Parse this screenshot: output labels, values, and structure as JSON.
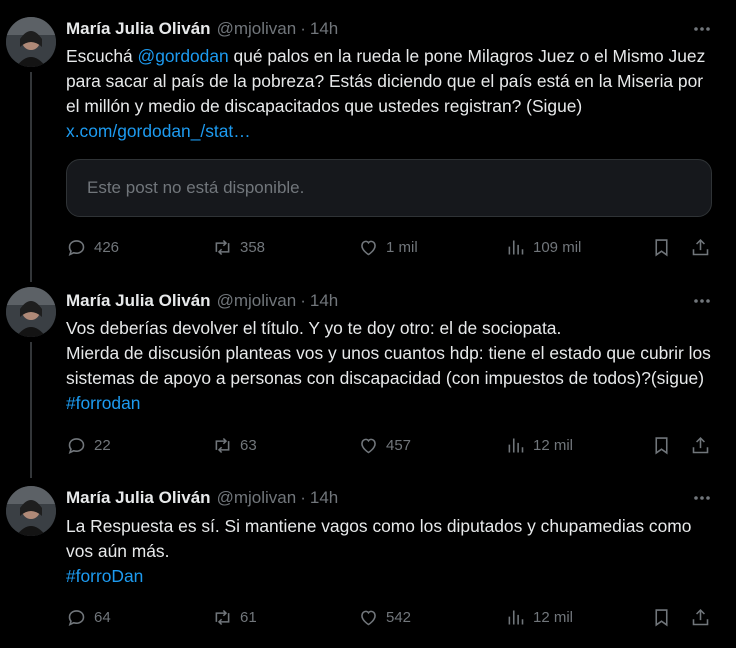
{
  "tweets": [
    {
      "author": {
        "name": "María Julia Oliván",
        "handle": "@mjolivan",
        "time": "14h"
      },
      "text_parts": {
        "p1": "Escuchá ",
        "mention": "@gordodan",
        "p2": " qué palos en la rueda le pone Milagros Juez o el Mismo Juez para sacar al país de la pobreza? Estás diciendo que el país está en la Miseria por el millón y medio de discapacitados que ustedes  registran? (Sigue) ",
        "link": "x.com/gordodan_/stat…"
      },
      "quoted_unavailable": "Este post no está disponible.",
      "stats": {
        "replies": "426",
        "reposts": "358",
        "likes": "1 mil",
        "views": "109 mil"
      }
    },
    {
      "author": {
        "name": "María Julia Oliván",
        "handle": "@mjolivan",
        "time": "14h"
      },
      "text_parts": {
        "p1": "Vos deberías devolver el título. Y yo te doy otro: el de sociopata.\nMierda de discusión planteas vos y unos cuantos hdp: tiene el estado que cubrir los sistemas de apoyo a personas con discapacidad (con impuestos de todos)?(sigue) ",
        "hashtag": "#forrodan"
      },
      "stats": {
        "replies": "22",
        "reposts": "63",
        "likes": "457",
        "views": "12 mil"
      }
    },
    {
      "author": {
        "name": "María Julia Oliván",
        "handle": "@mjolivan",
        "time": "14h"
      },
      "text_parts": {
        "p1": "La Respuesta es sí. Si mantiene vagos como los diputados y chupamedias como vos aún más.\n",
        "hashtag": "#forroDan"
      },
      "stats": {
        "replies": "64",
        "reposts": "61",
        "likes": "542",
        "views": "12 mil"
      }
    }
  ],
  "icons": {
    "more": "more-horizontal-icon",
    "reply": "reply-bubble-icon",
    "repost": "repost-arrows-icon",
    "like": "heart-icon",
    "views": "bar-chart-icon",
    "bookmark": "bookmark-icon",
    "share": "share-upload-icon"
  },
  "colors": {
    "background": "#000000",
    "text": "#e7e9ea",
    "secondary": "#71767b",
    "link": "#1d9bf0"
  }
}
